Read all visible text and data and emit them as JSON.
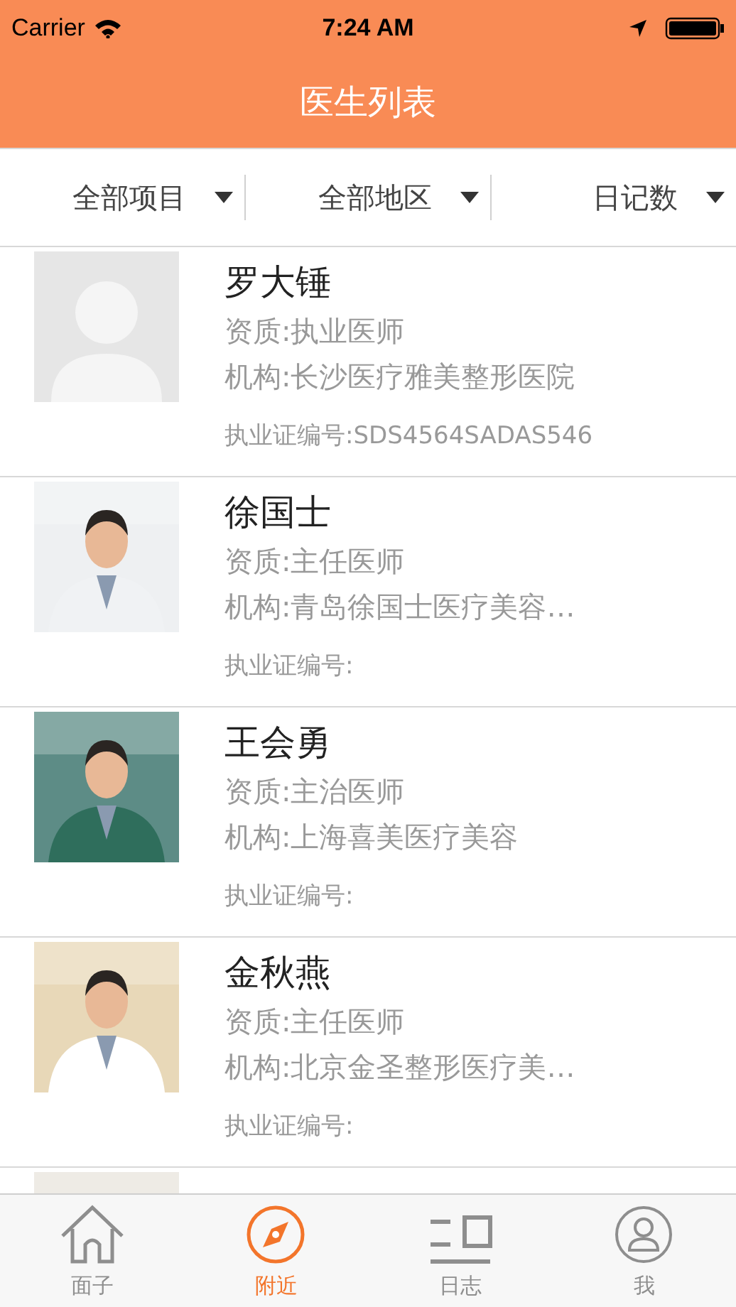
{
  "status_bar": {
    "carrier": "Carrier",
    "time": "7:24 AM"
  },
  "nav": {
    "title": "医生列表"
  },
  "filters": [
    {
      "label": "全部项目"
    },
    {
      "label": "全部地区"
    },
    {
      "label": "日记数"
    }
  ],
  "doctors": [
    {
      "kind": "placeholder",
      "name": "罗大锤",
      "qualification": "资质:执业医师",
      "institution": "机构:长沙医疗雅美整形医院",
      "license": "执业证编号:SDS4564SADAS546"
    },
    {
      "kind": "picture",
      "name": "徐国士",
      "qualification": "资质:主任医师",
      "institution": "机构:青岛徐国士医疗美容…",
      "license": "执业证编号:"
    },
    {
      "kind": "picture",
      "name": "王会勇",
      "qualification": "资质:主治医师",
      "institution": "机构:上海喜美医疗美容",
      "license": "执业证编号:"
    },
    {
      "kind": "picture",
      "name": "金秋燕",
      "qualification": "资质:主任医师",
      "institution": "机构:北京金圣整形医疗美…",
      "license": "执业证编号:"
    },
    {
      "kind": "picture"
    }
  ],
  "tabs": [
    {
      "label": "面子",
      "selected": false
    },
    {
      "label": "附近",
      "selected": true
    },
    {
      "label": "日志",
      "selected": false
    },
    {
      "label": "我",
      "selected": false
    }
  ]
}
